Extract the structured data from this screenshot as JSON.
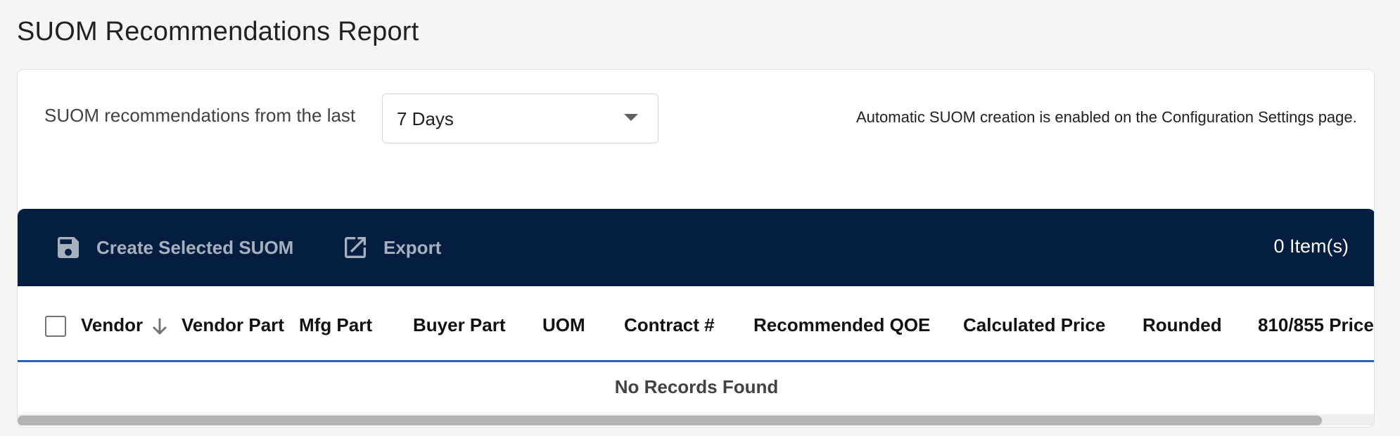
{
  "page": {
    "title": "SUOM Recommendations Report"
  },
  "filter": {
    "label": "SUOM recommendations from the last",
    "selected": "7 Days"
  },
  "note": "Automatic SUOM creation is enabled on the Configuration Settings page.",
  "toolbar": {
    "create_label": "Create Selected SUOM",
    "create_icon": "save-icon",
    "export_label": "Export",
    "export_icon": "open-in-new-icon",
    "item_count": "0 Item(s)",
    "background": "#041e42"
  },
  "table": {
    "columns": [
      "Vendor",
      "Vendor Part",
      "Mfg Part",
      "Buyer Part",
      "UOM",
      "Contract #",
      "Recommended QOE",
      "Calculated Price",
      "Rounded",
      "810/855 Price"
    ],
    "sort_icon": "arrow-down-icon",
    "empty_message": "No Records Found",
    "header_border_color": "#2f5fb3"
  }
}
